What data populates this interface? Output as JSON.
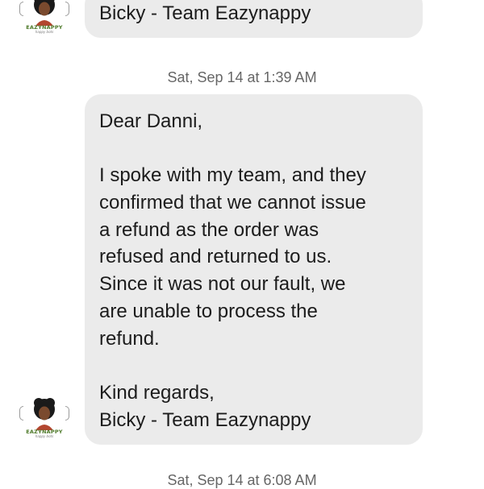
{
  "messages": [
    {
      "lines": [
        "Bicky - Team Eazynappy"
      ]
    },
    {
      "timestamp": "Sat, Sep 14 at 1:39 AM",
      "lines": [
        "Dear Danni,",
        "",
        "I spoke with my team, and they",
        "confirmed that we cannot issue",
        "a refund as the order was",
        "refused and returned to us.",
        "Since it was not our fault, we",
        "are unable to process the",
        "refund.",
        "",
        "Kind regards,",
        "Bicky - Team Eazynappy"
      ]
    },
    {
      "timestamp": "Sat, Sep 14 at 6:08 AM"
    }
  ],
  "avatar": {
    "brand": "EAZYNAPPY",
    "tagline": "happy bots"
  },
  "colors": {
    "bubble": "#ebebeb",
    "text": "#1c1c1c",
    "timestamp": "#666666",
    "brand_green": "#4e7a2a"
  }
}
